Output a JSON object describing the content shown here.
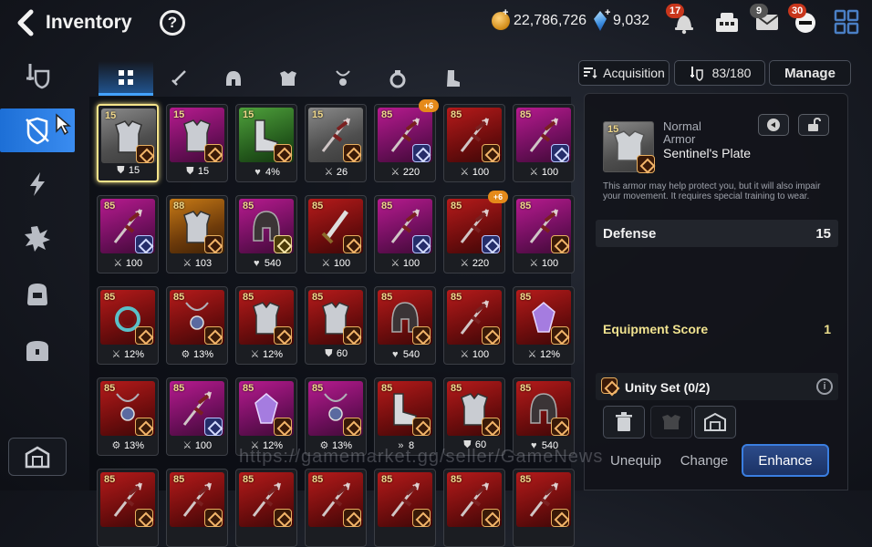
{
  "header": {
    "title": "Inventory",
    "help_label": "?",
    "gold": "22,786,726",
    "gems": "9,032",
    "notification_badge": "17",
    "mail_badge": "9",
    "chat_badge": "30"
  },
  "sidebar": {
    "items": [
      {
        "icon": "sword-shield-icon"
      },
      {
        "icon": "armor-icon",
        "active": true
      },
      {
        "icon": "lightning-icon"
      },
      {
        "icon": "burst-icon"
      },
      {
        "icon": "bag-icon"
      },
      {
        "icon": "chest-icon"
      }
    ],
    "storage_icon": "storage-icon"
  },
  "tabs": [
    "all",
    "weapon",
    "helmet",
    "armor",
    "necklace",
    "ring",
    "boots"
  ],
  "right_header": {
    "acquisition_label": "Acquisition",
    "capacity": "83/180",
    "manage_label": "Manage"
  },
  "grid": {
    "rows": [
      [
        {
          "level": "15",
          "rarity": "normal",
          "kind": "armor",
          "stat_icon": "shield",
          "stat": "15",
          "badge": "orange",
          "selected": true
        },
        {
          "level": "15",
          "rarity": "magic",
          "kind": "armor",
          "stat_icon": "shield",
          "stat": "15",
          "badge": "orange"
        },
        {
          "level": "15",
          "rarity": "rare",
          "kind": "boots",
          "stat_icon": "heart",
          "stat": "4%",
          "badge": "orange"
        },
        {
          "level": "15",
          "rarity": "normal",
          "kind": "spear",
          "stat_icon": "sword",
          "stat": "26",
          "badge": "orange"
        },
        {
          "level": "85",
          "rarity": "magic",
          "kind": "spear",
          "stat_icon": "sword",
          "stat": "220",
          "badge": "blue",
          "upgrade": "+6"
        },
        {
          "level": "85",
          "rarity": "epic",
          "kind": "spear",
          "stat_icon": "sword",
          "stat": "100",
          "badge": "orange"
        },
        {
          "level": "85",
          "rarity": "magic",
          "kind": "spear",
          "stat_icon": "sword",
          "stat": "100",
          "badge": "blue"
        }
      ],
      [
        {
          "level": "85",
          "rarity": "magic",
          "kind": "spear",
          "stat_icon": "sword",
          "stat": "100",
          "badge": "blue"
        },
        {
          "level": "88",
          "rarity": "heroic",
          "kind": "armor",
          "stat_icon": "sword",
          "stat": "103",
          "badge": "orange"
        },
        {
          "level": "85",
          "rarity": "magic",
          "kind": "helmet",
          "stat_icon": "heart",
          "stat": "540",
          "badge": "gold"
        },
        {
          "level": "85",
          "rarity": "epic",
          "kind": "sword",
          "stat_icon": "sword",
          "stat": "100",
          "badge": "orange"
        },
        {
          "level": "85",
          "rarity": "magic",
          "kind": "spear",
          "stat_icon": "sword",
          "stat": "100",
          "badge": "blue"
        },
        {
          "level": "85",
          "rarity": "epic",
          "kind": "spear",
          "stat_icon": "sword",
          "stat": "220",
          "badge": "blue",
          "upgrade": "+6"
        },
        {
          "level": "85",
          "rarity": "magic",
          "kind": "spear",
          "stat_icon": "sword",
          "stat": "100",
          "badge": "orange"
        }
      ],
      [
        {
          "level": "85",
          "rarity": "epic",
          "kind": "ring",
          "stat_icon": "sword",
          "stat": "12%",
          "badge": "orange"
        },
        {
          "level": "85",
          "rarity": "epic",
          "kind": "necklace",
          "stat_icon": "gear",
          "stat": "13%",
          "badge": "orange"
        },
        {
          "level": "85",
          "rarity": "epic",
          "kind": "armor",
          "stat_icon": "sword",
          "stat": "12%",
          "badge": "orange"
        },
        {
          "level": "85",
          "rarity": "epic",
          "kind": "armor",
          "stat_icon": "shield",
          "stat": "60",
          "badge": "orange"
        },
        {
          "level": "85",
          "rarity": "epic",
          "kind": "helmet",
          "stat_icon": "heart",
          "stat": "540",
          "badge": "orange"
        },
        {
          "level": "85",
          "rarity": "epic",
          "kind": "spear",
          "stat_icon": "sword",
          "stat": "100",
          "badge": "orange"
        },
        {
          "level": "85",
          "rarity": "epic",
          "kind": "gem",
          "stat_icon": "sword",
          "stat": "12%",
          "badge": "orange"
        }
      ],
      [
        {
          "level": "85",
          "rarity": "epic",
          "kind": "necklace",
          "stat_icon": "gear",
          "stat": "13%",
          "badge": "orange"
        },
        {
          "level": "85",
          "rarity": "magic",
          "kind": "spear",
          "stat_icon": "sword",
          "stat": "100",
          "badge": "blue"
        },
        {
          "level": "85",
          "rarity": "magic",
          "kind": "gem",
          "stat_icon": "sword",
          "stat": "12%",
          "badge": "orange"
        },
        {
          "level": "85",
          "rarity": "magic",
          "kind": "necklace",
          "stat_icon": "gear",
          "stat": "13%",
          "badge": "orange"
        },
        {
          "level": "85",
          "rarity": "epic",
          "kind": "boots",
          "stat_icon": "arrow",
          "stat": "8",
          "badge": "orange"
        },
        {
          "level": "85",
          "rarity": "epic",
          "kind": "armor",
          "stat_icon": "shield",
          "stat": "60",
          "badge": "orange"
        },
        {
          "level": "85",
          "rarity": "epic",
          "kind": "helmet",
          "stat_icon": "heart",
          "stat": "540",
          "badge": "orange"
        }
      ],
      [
        {
          "level": "85",
          "rarity": "epic",
          "kind": "spear",
          "stat_icon": "sword",
          "stat": "",
          "badge": "orange"
        },
        {
          "level": "85",
          "rarity": "epic",
          "kind": "spear",
          "stat_icon": "sword",
          "stat": "",
          "badge": "orange"
        },
        {
          "level": "85",
          "rarity": "epic",
          "kind": "spear",
          "stat_icon": "sword",
          "stat": "",
          "badge": "orange"
        },
        {
          "level": "85",
          "rarity": "epic",
          "kind": "spear",
          "stat_icon": "sword",
          "stat": "",
          "badge": "orange"
        },
        {
          "level": "85",
          "rarity": "epic",
          "kind": "spear",
          "stat_icon": "sword",
          "stat": "",
          "badge": "orange"
        },
        {
          "level": "85",
          "rarity": "epic",
          "kind": "spear",
          "stat_icon": "sword",
          "stat": "",
          "badge": "orange"
        },
        {
          "level": "85",
          "rarity": "epic",
          "kind": "spear",
          "stat_icon": "sword",
          "stat": "",
          "badge": "orange"
        }
      ]
    ]
  },
  "detail": {
    "level": "15",
    "grade": "Normal",
    "type": "Armor",
    "name": "Sentinel's Plate",
    "description": "This armor may help protect you, but it will also impair your movement. It requires special training to wear.",
    "stat_name": "Defense",
    "stat_value": "15",
    "score_label": "Equipment Score",
    "score_value": "1",
    "unity_label": "Unity Set (0/2)",
    "info_label": "i",
    "buttons": {
      "unequip": "Unequip",
      "change": "Change",
      "enhance": "Enhance"
    }
  },
  "watermark": "https://gamemarket.gg/seller/GameNews",
  "colors": {
    "accent_blue": "#3a8cf0",
    "level_gold": "#f1d98c",
    "score_gold": "#f0e28f",
    "badge_red": "#c8361c"
  }
}
